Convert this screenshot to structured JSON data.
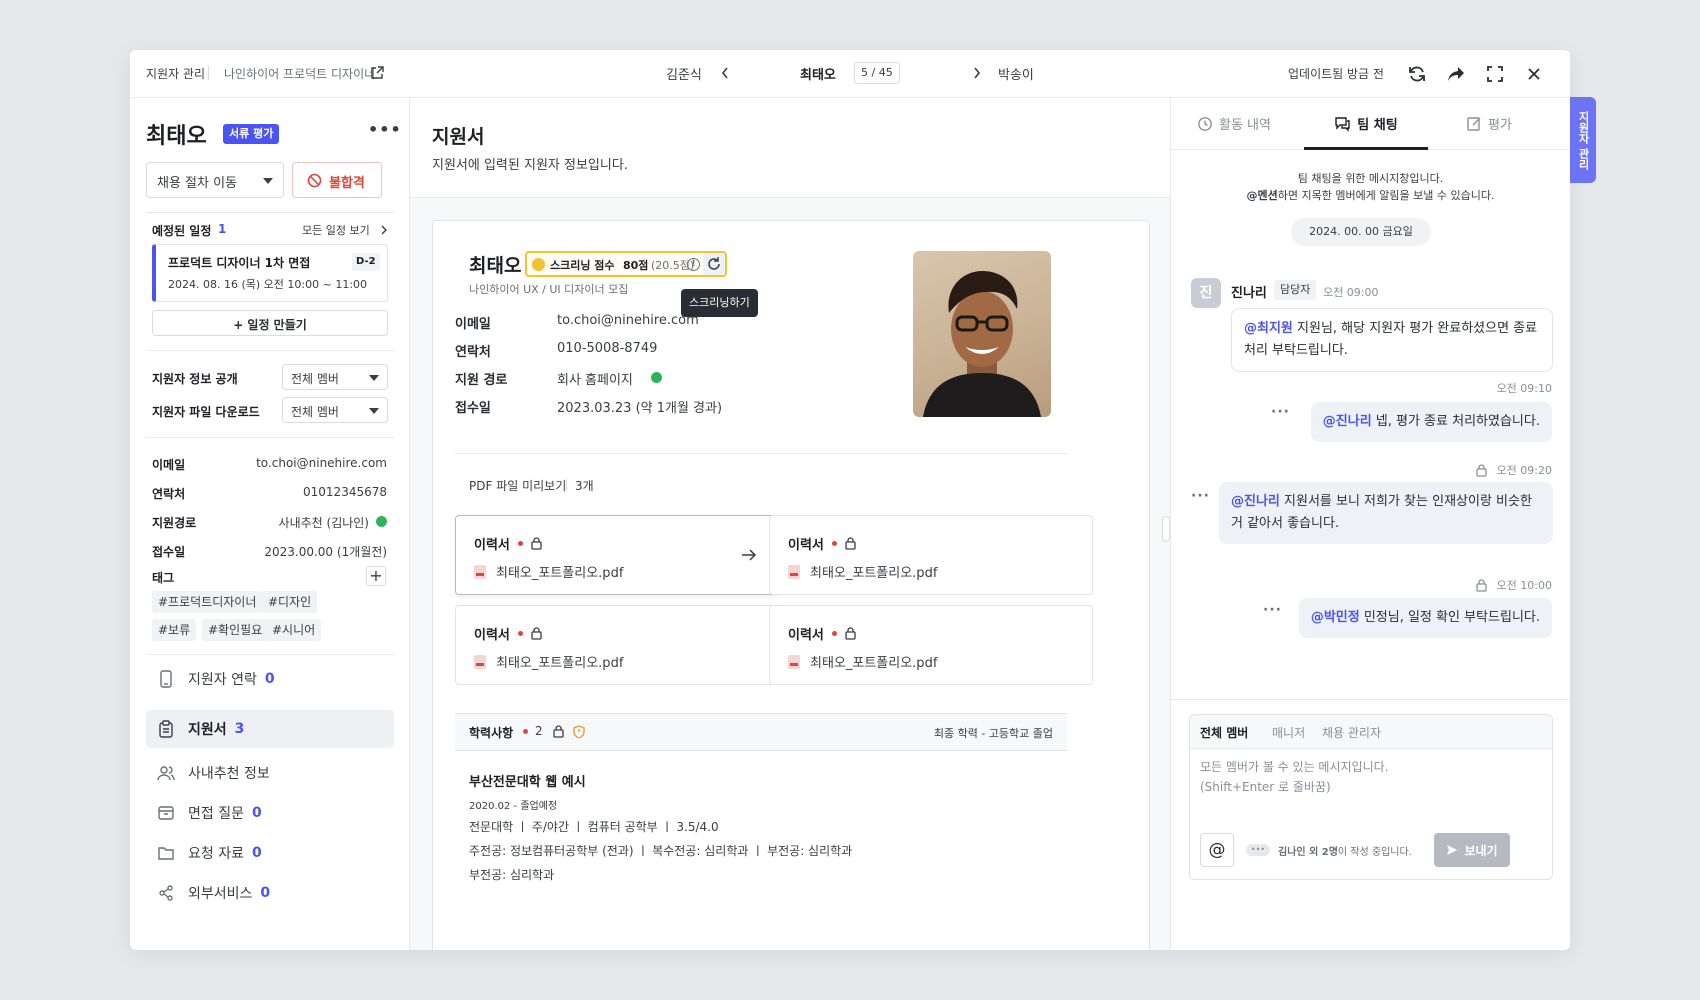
{
  "topbar": {
    "breadcrumb_root": "지원자 관리",
    "breadcrumb_job": "나인하이어 프로덕트 디자이너",
    "prev_name": "김준식",
    "current_name": "최태오",
    "counter": "5 / 45",
    "next_name": "박송이",
    "updated": "업데이트됨 방금 전"
  },
  "side_tab": "지원자 관리",
  "left": {
    "name": "최태오",
    "stage_badge": "서류 평가",
    "move_select": "채용 절차 이동",
    "reject_button": "불합격",
    "schedule_title": "예정된 일정",
    "schedule_count": "1",
    "schedule_all": "모든 일정 보기",
    "event_title": "프로덕트 디자이너 1차 면접",
    "event_dday": "D-2",
    "event_time": "2024. 08. 16 (목) 오전 10:00 ~ 11:00",
    "add_event": "+ 일정 만들기",
    "share_label": "지원자 정보 공개",
    "share_value": "전체 멤버",
    "download_label": "지원자 파일 다운로드",
    "download_value": "전체 멤버",
    "info": {
      "email_label": "이메일",
      "email": "to.choi@ninehire.com",
      "phone_label": "연락처",
      "phone": "01012345678",
      "route_label": "지원경로",
      "route": "사내추천 (김나인)",
      "date_label": "접수일",
      "date": "2023.00.00 (1개월전)",
      "tags_label": "태그"
    },
    "tags": [
      "#프로덕트디자이너",
      "#디자인",
      "#보류",
      "#확인필요",
      "#시니어"
    ],
    "nav": [
      {
        "label": "지원자 연락",
        "count": "0"
      },
      {
        "label": "지원서",
        "count": "3"
      },
      {
        "label": "사내추천 정보",
        "count": ""
      },
      {
        "label": "면접 질문",
        "count": "0"
      },
      {
        "label": "요청 자료",
        "count": "0"
      },
      {
        "label": "외부서비스",
        "count": "0"
      }
    ]
  },
  "mid": {
    "title": "지원서",
    "subtitle": "지원서에 입력된 지원자 정보입니다.",
    "name": "최태오",
    "score_label": "스크리닝 점수",
    "score": "80점",
    "score_detail": "(20.5점)",
    "tooltip": "스크리닝하기",
    "position": "나인하이어 UX / UI 디자이너 모집",
    "fields": {
      "email_label": "이메일",
      "email": "to.choi@ninehire.com",
      "phone_label": "연락처",
      "phone": "010-5008-8749",
      "route_label": "지원 경로",
      "route": "회사 홈페이지",
      "date_label": "접수일",
      "date": "2023.03.23 (약 1개월 경과)"
    },
    "pdf_title": "PDF 파일 미리보기",
    "pdf_count": "3개",
    "files": [
      {
        "type": "이력서",
        "name": "최태오_포트폴리오.pdf"
      },
      {
        "type": "이력서",
        "name": "최태오_포트폴리오.pdf"
      },
      {
        "type": "이력서",
        "name": "최태오_포트폴리오.pdf"
      },
      {
        "type": "이력서",
        "name": "최태오_포트폴리오.pdf"
      }
    ],
    "edu_title": "학력사항",
    "edu_count": "2",
    "edu_final": "최종 학력 - 고등학교 졸업",
    "school": "부산전문대학 웹 예시",
    "school_date": "2020.02 - 졸업예정",
    "school_info": "전문대학 ㅣ 주/야간 ㅣ 컴퓨터 공학부 ㅣ 3.5/4.0",
    "school_major": "주전공: 정보컴퓨터공학부 (전과) ㅣ 복수전공: 심리학과 ㅣ 부전공: 심리학과",
    "school_minor": "부전공: 심리학과"
  },
  "right": {
    "tabs": [
      "활동 내역",
      "팀 채팅",
      "평가"
    ],
    "intro1": "팀 채팅을 위한 메시지창입니다.",
    "intro_mention": "@멘션",
    "intro2": "하면 지목한 멤버에게 알림을 보낼 수 있습니다.",
    "date_pill": "2024. 00. 00 금요일",
    "author_avatar": "진",
    "author": "진나리",
    "author_role": "담당자",
    "msg1_time": "오전 09:00",
    "msg1_mention": "@최지원",
    "msg1_text": " 지원님, 해당 지원자 평가 완료하셨으면 종료 처리 부탁드립니다.",
    "msg2_time": "오전 09:10",
    "msg2_mention": "@진나리",
    "msg2_text": " 넵, 평가 종료 처리하였습니다.",
    "msg3_time": "오전 09:20",
    "msg3_mention": "@진나리",
    "msg3_text": " 지원서를 보니 저희가 찾는 인재상이랑 비슷한 거 같아서 좋습니다.",
    "msg4_time": "오전 10:00",
    "msg4_mention": "@박민정",
    "msg4_text": " 민정님, 일정 확인 부탁드립니다.",
    "composer_tabs": [
      "전체 멤버",
      "매니저",
      "채용 관리자"
    ],
    "placeholder1": "모든 멤버가 볼 수 있는 메시지입니다.",
    "placeholder2": "(Shift+Enter 로 줄바꿈)",
    "at_symbol": "@",
    "typing_name": "김나인 외 2명",
    "typing_text": "이 작성 중입니다.",
    "send": "보내기"
  },
  "colors": {
    "accent": "#4b53f2",
    "danger": "#e0463a",
    "score_border": "#f2c230",
    "success": "#2fb35a"
  }
}
